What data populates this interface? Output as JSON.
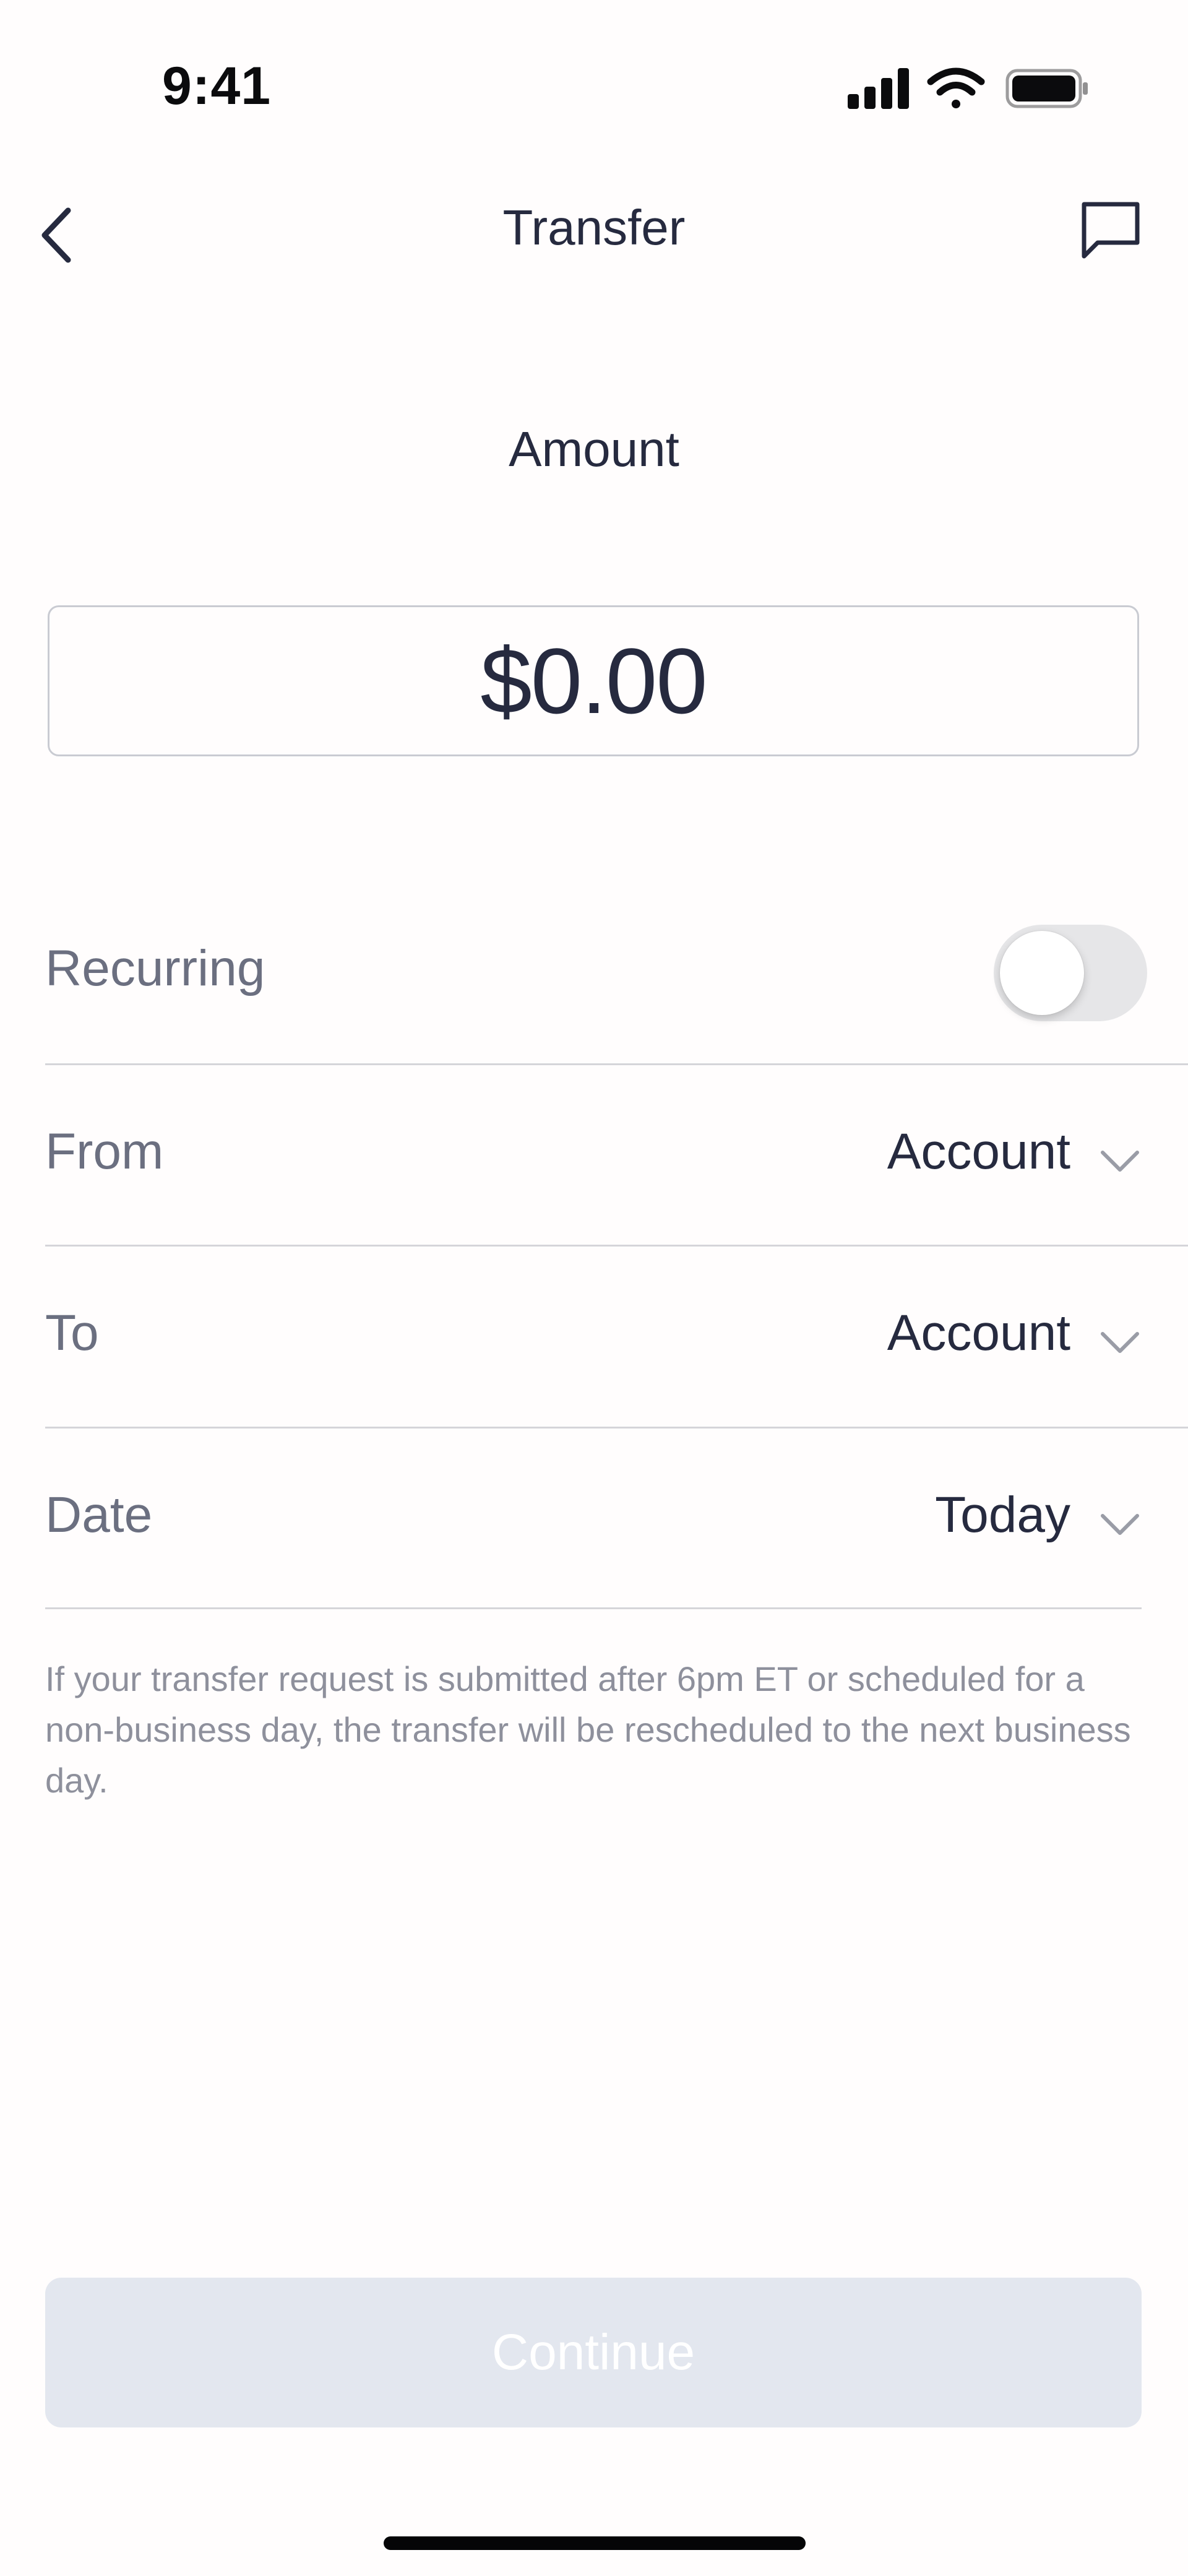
{
  "status_bar": {
    "time": "9:41",
    "icons": [
      "cellular-signal-icon",
      "wifi-icon",
      "battery-icon"
    ]
  },
  "nav": {
    "title": "Transfer",
    "back_icon": "chevron-left-icon",
    "chat_icon": "chat-bubble-icon"
  },
  "amount": {
    "label": "Amount",
    "value": "$0.00"
  },
  "form": {
    "recurring": {
      "label": "Recurring",
      "enabled": false
    },
    "from": {
      "label": "From",
      "value": "Account"
    },
    "to": {
      "label": "To",
      "value": "Account"
    },
    "date": {
      "label": "Date",
      "value": "Today"
    }
  },
  "disclaimer": "If your transfer request is submitted after 6pm ET or scheduled for a non-business day, the transfer will be rescheduled to the next business day.",
  "continue_button": {
    "label": "Continue",
    "disabled": true
  },
  "colors": {
    "text_primary": "#262a3f",
    "text_secondary": "#6b6f80",
    "disabled_button_bg": "#e3e7ef",
    "toggle_off_bg": "#e6e6e8"
  }
}
